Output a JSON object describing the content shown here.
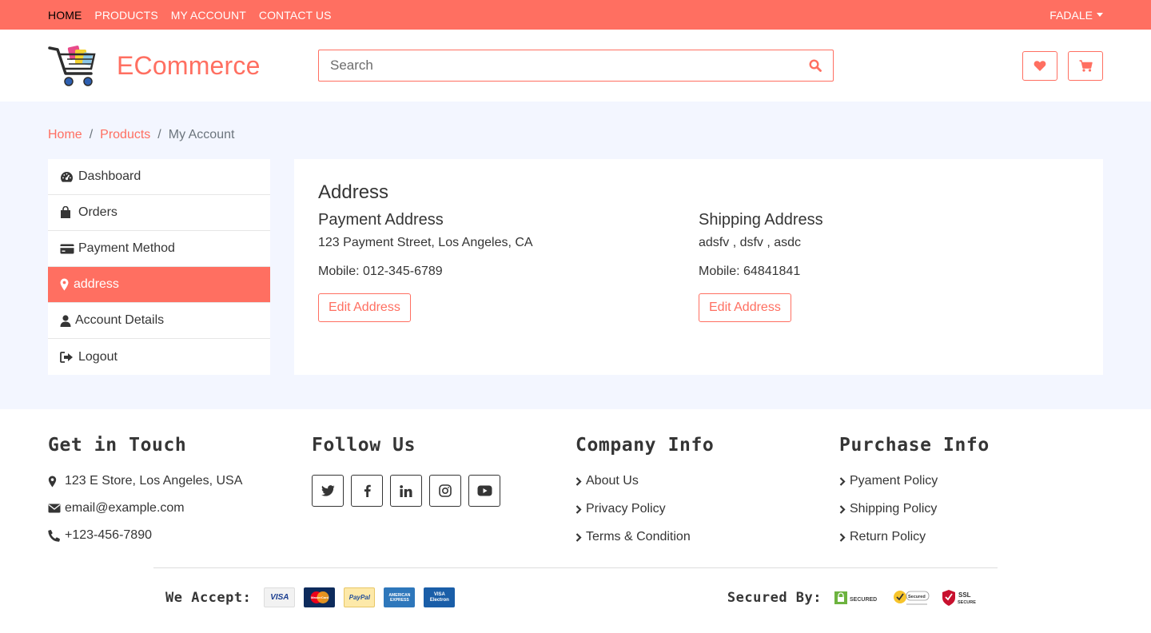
{
  "topbar": {
    "nav": [
      "HOME",
      "PRODUCTS",
      "MY ACCOUNT",
      "CONTACT US"
    ],
    "user": "FADALE"
  },
  "header": {
    "brand": "ECommerce",
    "search_placeholder": "Search"
  },
  "breadcrumb": {
    "home": "Home",
    "products": "Products",
    "current": "My Account",
    "separator": "/"
  },
  "sidebar": {
    "items": [
      {
        "label": "Dashboard",
        "icon": "tachometer-icon"
      },
      {
        "label": "Orders",
        "icon": "shopping-bag-icon"
      },
      {
        "label": "Payment Method",
        "icon": "credit-card-icon"
      },
      {
        "label": "address",
        "icon": "map-marker-icon",
        "active": true
      },
      {
        "label": "Account Details",
        "icon": "user-icon"
      },
      {
        "label": "Logout",
        "icon": "sign-out-icon"
      }
    ]
  },
  "panel": {
    "title": "Address",
    "payment": {
      "heading": "Payment Address",
      "address": "123 Payment Street, Los Angeles, CA",
      "mobile": "Mobile: 012-345-6789",
      "button": "Edit Address"
    },
    "shipping": {
      "heading": "Shipping Address",
      "address": "adsfv , dsfv , asdc",
      "mobile": "Mobile: 64841841",
      "button": "Edit Address"
    }
  },
  "footer": {
    "touch": {
      "title": "Get in Touch",
      "address": "123 E Store, Los Angeles, USA",
      "email": "email@example.com",
      "phone": "+123-456-7890"
    },
    "follow": {
      "title": "Follow Us",
      "icons": [
        "twitter-icon",
        "facebook-icon",
        "linkedin-icon",
        "instagram-icon",
        "youtube-icon"
      ]
    },
    "company": {
      "title": "Company Info",
      "links": [
        "About Us",
        "Privacy Policy",
        "Terms & Condition"
      ]
    },
    "purchase": {
      "title": "Purchase Info",
      "links": [
        "Pyament Policy",
        "Shipping Policy",
        "Return Policy"
      ]
    },
    "accept_label": "We Accept:",
    "secured_label": "Secured By:",
    "cards": [
      "VISA",
      "MasterCard",
      "PayPal",
      "AMERICAN EXPRESS",
      "VISA Electron"
    ],
    "seals": [
      "SECURED",
      "Secured",
      "SSL SECURE"
    ]
  },
  "colors": {
    "accent": "#ff6f61",
    "page_bg": "#f3f6ff",
    "text": "#353535"
  }
}
